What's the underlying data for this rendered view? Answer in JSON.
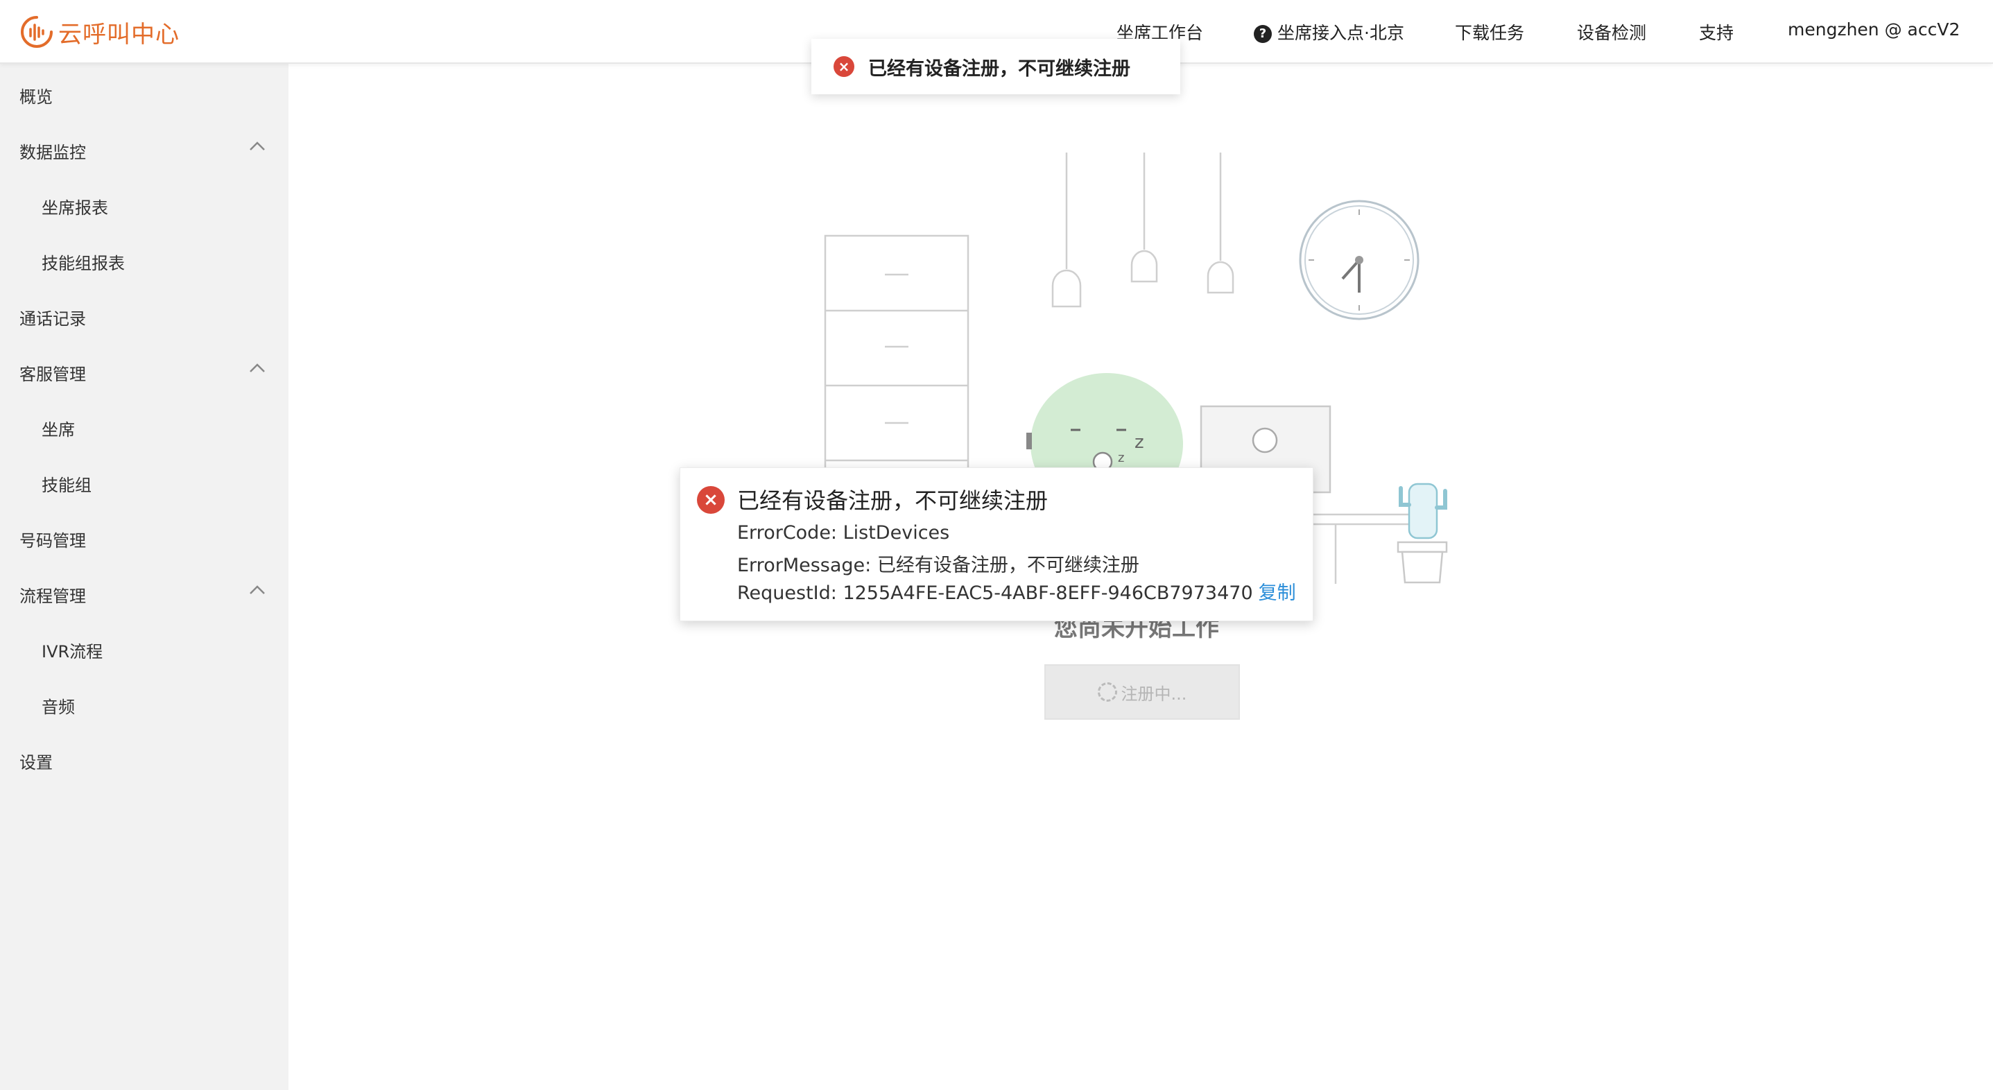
{
  "app": {
    "logo_text": "云呼叫中心",
    "brand_color": "#e36c2a"
  },
  "header": {
    "nav": [
      {
        "label": "坐席工作台"
      },
      {
        "label": "坐席接入点·北京",
        "icon": "help-icon"
      },
      {
        "label": "下载任务"
      },
      {
        "label": "设备检测"
      },
      {
        "label": "支持"
      },
      {
        "label": "mengzhen @ accV2"
      }
    ]
  },
  "sidebar": {
    "items": [
      {
        "label": "概览"
      },
      {
        "label": "数据监控",
        "expanded": true
      },
      {
        "label": "坐席报表"
      },
      {
        "label": "技能组报表"
      },
      {
        "label": "通话记录"
      },
      {
        "label": "客服管理",
        "expanded": true
      },
      {
        "label": "坐席"
      },
      {
        "label": "技能组"
      },
      {
        "label": "号码管理"
      },
      {
        "label": "流程管理",
        "expanded": true
      },
      {
        "label": "IVR流程"
      },
      {
        "label": "音频"
      },
      {
        "label": "设置"
      }
    ]
  },
  "main": {
    "caption": "您尚未开始工作",
    "register_button": "注册中..."
  },
  "toast": {
    "message": "已经有设备注册，不可继续注册"
  },
  "dialog": {
    "title": "已经有设备注册，不可继续注册",
    "error_code": "ErrorCode: ListDevices",
    "error_message": "ErrorMessage: 已经有设备注册，不可继续注册",
    "request_id": "RequestId: 1255A4FE-EAC5-4ABF-8EFF-946CB7973470",
    "copy_label": "复制",
    "error_color": "#d9473a",
    "link_color": "#2b8ed9"
  }
}
